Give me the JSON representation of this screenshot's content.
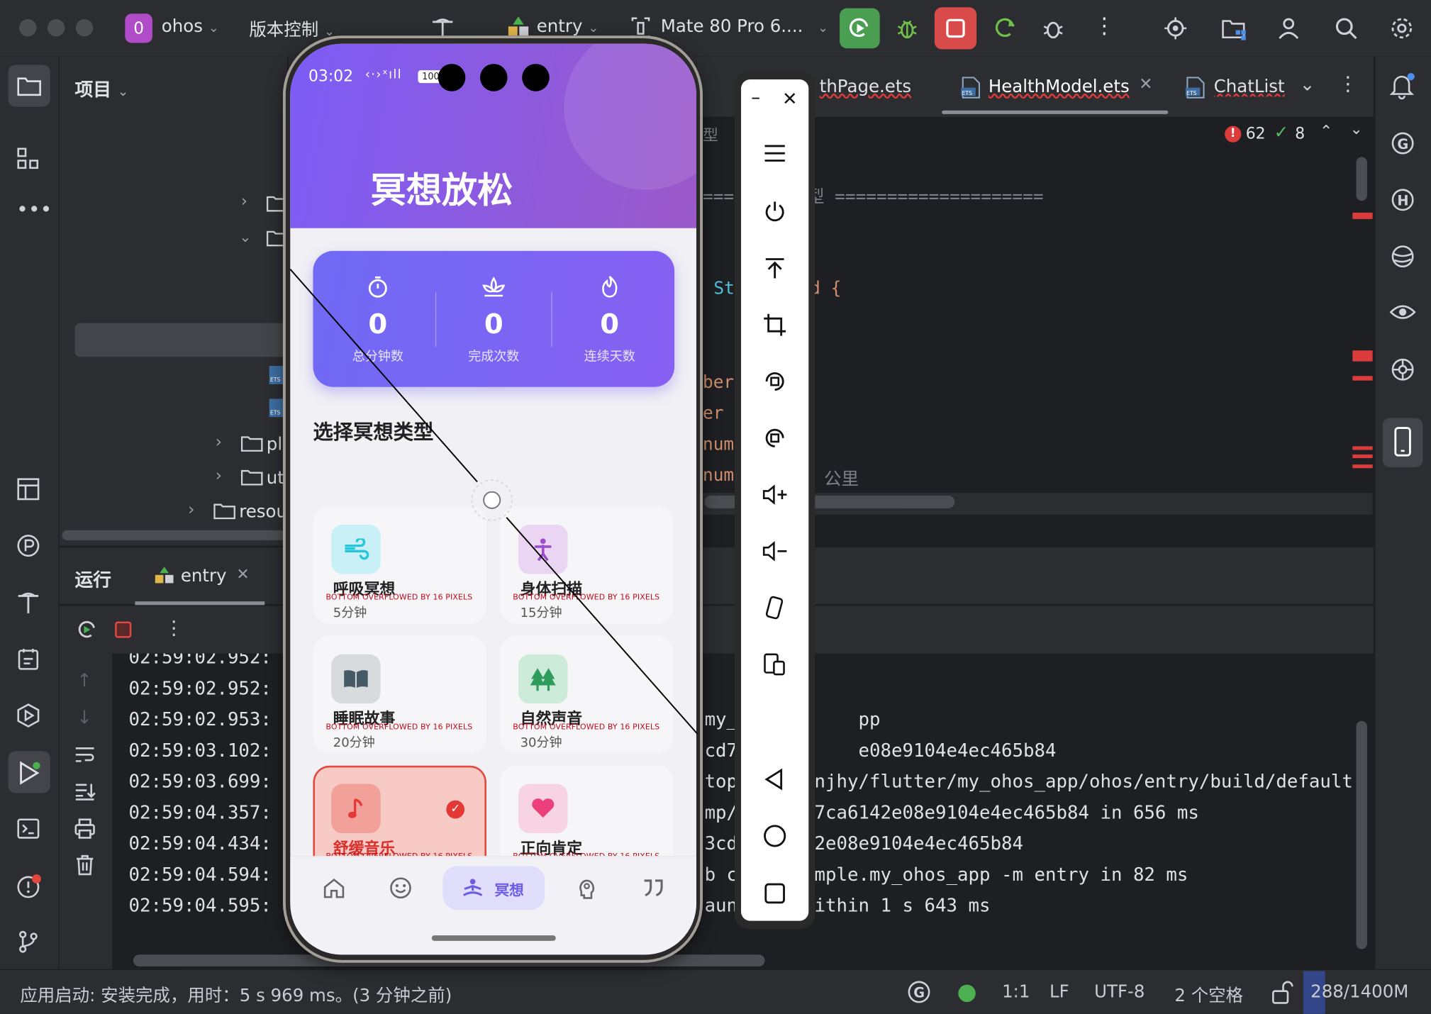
{
  "topbar": {
    "project_badge": "0",
    "project_name": "ohos",
    "vcs_label": "版本控制",
    "run_config": "entry",
    "device": "Mate 80 Pro 6...."
  },
  "project_panel": {
    "title": "项目",
    "tree_items": [
      {
        "label": "pl"
      },
      {
        "label": "ut"
      },
      {
        "label": "resou"
      }
    ]
  },
  "editor": {
    "tabs": [
      {
        "label": "thPage.ets"
      },
      {
        "label": "HealthModel.ets"
      },
      {
        "label": "ChatList"
      }
    ],
    "errors": "62",
    "warnings": "8",
    "breadcrumb": "型",
    "code_lines": [
      {
        "text": "==== 原有模型 ===================="
      },
      {
        "text": "St"
      },
      {
        "text": "rd {"
      },
      {
        "text": "ber"
      },
      {
        "text": "er"
      },
      {
        "text": "numb"
      },
      {
        "text": "numb"
      },
      {
        "text": "/ 公里"
      }
    ]
  },
  "run_panel": {
    "title": "运行",
    "tab": "entry",
    "log_lines": [
      {
        "time": "02:59:02.952:",
        "tail": ""
      },
      {
        "time": "02:59:02.952:",
        "tail": ""
      },
      {
        "time": "02:59:02.953:",
        "tail": "my_           pp"
      },
      {
        "time": "02:59:03.102:",
        "tail": "cd7           e08e9104e4ec465b84"
      },
      {
        "time": "02:59:03.699:",
        "tail": "top/     injhy/flutter/my_ohos_app/ohos/entry/build/default"
      },
      {
        "time": "02:59:04.357:",
        "tail": "mp/      d7ca6142e08e9104e4ec465b84 in 656 ms"
      },
      {
        "time": "02:59:04.434:",
        "tail": "3cd7      2e08e9104e4ec465b84"
      },
      {
        "time": "02:59:04.594:",
        "tail": "b c       mple.my_ohos_app -m entry in 82 ms"
      },
      {
        "time": "02:59:04.595:",
        "tail": "aun       ithin 1 s 643 ms"
      }
    ]
  },
  "phone": {
    "status_time": "03:02",
    "status_battery": "100",
    "header_title": "冥想放松",
    "stats": [
      {
        "value": "0",
        "label": "总分钟数",
        "icon": "timer-icon"
      },
      {
        "value": "0",
        "label": "完成次数",
        "icon": "lotus-icon"
      },
      {
        "value": "0",
        "label": "连续天数",
        "icon": "flame-icon"
      }
    ],
    "section_title": "选择冥想类型",
    "overflow_text": "BOTTOM OVERFLOWED BY 16 PIXELS",
    "cards": [
      {
        "title": "呼吸冥想",
        "duration": "5分钟",
        "icon": "wind-icon",
        "color": "#25c6da"
      },
      {
        "title": "身体扫描",
        "duration": "15分钟",
        "icon": "figure-icon",
        "color": "#9c4dcc"
      },
      {
        "title": "睡眠故事",
        "duration": "20分钟",
        "icon": "book-icon",
        "color": "#455a64"
      },
      {
        "title": "自然声音",
        "duration": "30分钟",
        "icon": "tree-icon",
        "color": "#2e9d5b"
      },
      {
        "title": "舒缓音乐",
        "duration": "",
        "icon": "music-note-icon",
        "color": "#e53935"
      },
      {
        "title": "正向肯定",
        "duration": "",
        "icon": "heart-icon",
        "color": "#ec407a"
      }
    ],
    "nav": [
      {
        "icon": "home-icon",
        "label": ""
      },
      {
        "icon": "smile-icon",
        "label": ""
      },
      {
        "icon": "meditate-icon",
        "label": "冥想"
      },
      {
        "icon": "brain-icon",
        "label": ""
      },
      {
        "icon": "quote-icon",
        "label": ""
      }
    ]
  },
  "statusbar": {
    "message": "应用启动: 安装完成，用时：5 s 969 ms。(3 分钟之前)",
    "position": "1:1",
    "line_sep": "LF",
    "encoding": "UTF-8",
    "indent": "2 个空格",
    "memory": "288/1400M"
  },
  "colors": {
    "accent_purple": "#7b61ff",
    "header_gradient_start": "#7c5cf6",
    "header_gradient_end": "#9b59c9",
    "run_green": "#4caf50",
    "stop_red": "#d94a4a",
    "error_red": "#db3b3b"
  }
}
